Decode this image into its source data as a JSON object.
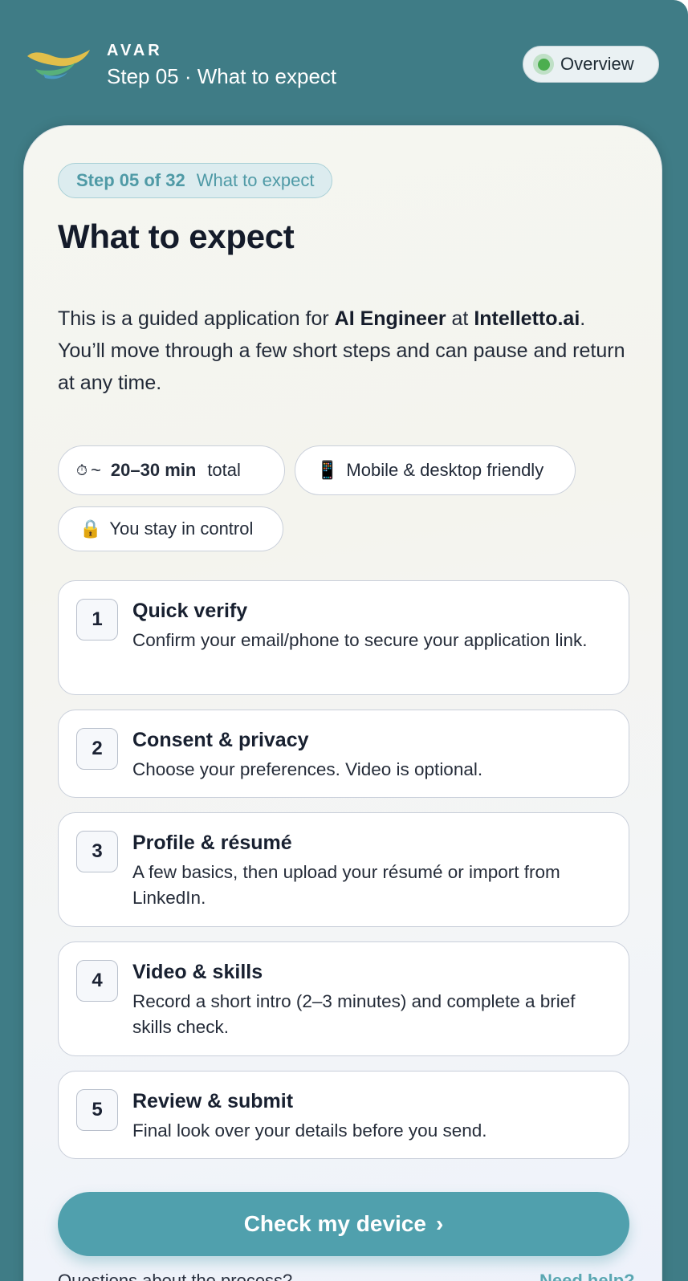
{
  "header": {
    "brand": "AVAR",
    "step_label": "Step 05 · What to expect",
    "overview_label": "Overview"
  },
  "card": {
    "step_count": "Step 05 of 32",
    "step_name": "What to expect",
    "title": "What to expect",
    "intro": {
      "part1": "This is a guided application for ",
      "role": "AI Engineer",
      "part2": " at ",
      "company": "Intelletto.ai",
      "part3": ". You’ll move through a few short steps and can pause and return at any time."
    },
    "chips": {
      "time_icon": "⏱",
      "time_prefix": "~",
      "time_value": "20–30 min",
      "time_suffix": "total",
      "device_icon": "📱",
      "device_label": "Mobile & desktop friendly",
      "control_icon": "🔒",
      "control_label": "You stay in control"
    },
    "steps": [
      {
        "num": "1",
        "title": "Quick verify",
        "desc": "Confirm your email/phone to secure your application link."
      },
      {
        "num": "2",
        "title": "Consent & privacy",
        "desc": "Choose your preferences. Video is optional."
      },
      {
        "num": "3",
        "title": "Profile & résumé",
        "desc": "A few basics, then upload your résumé or import from LinkedIn."
      },
      {
        "num": "4",
        "title": "Video & skills",
        "desc": "Record a short intro (2–3 minutes) and complete a brief skills check."
      },
      {
        "num": "5",
        "title": "Review & submit",
        "desc": "Final look over your details before you send."
      }
    ],
    "cta_label": "Check my device",
    "cta_chevron": "›",
    "footer_question": "Questions about the process?",
    "footer_help": "Need help?"
  },
  "colors": {
    "frame": "#3f7c86",
    "accent": "#50a0ad",
    "status_green": "#4cae4f"
  }
}
